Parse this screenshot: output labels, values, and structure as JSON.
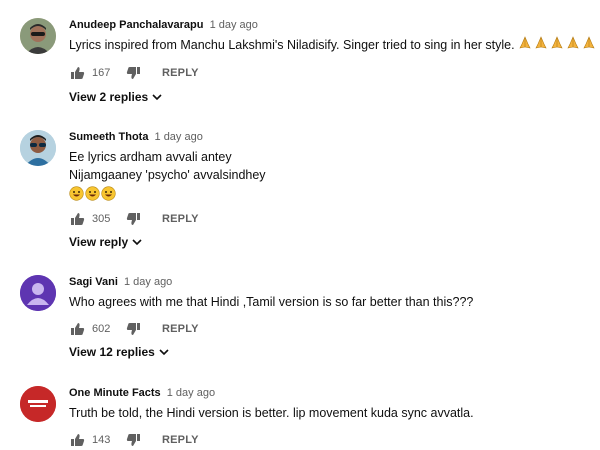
{
  "comments": [
    {
      "author": "Anudeep Panchalavarapu",
      "time": "1 day ago",
      "lines": [
        "Lyrics inspired from Manchu Lakshmi's Niladisify. Singer tried to sing in her style."
      ],
      "emoji_suffix": [
        "folded-hands-icon",
        "folded-hands-icon",
        "folded-hands-icon",
        "folded-hands-icon",
        "folded-hands-icon"
      ],
      "likes": "167",
      "reply_label": "REPLY",
      "replies_label": "View 2 replies"
    },
    {
      "author": "Sumeeth Thota",
      "time": "1 day ago",
      "lines": [
        "Ee lyrics ardham avvali antey",
        "Nijamgaaney 'psycho' avvalsindhey"
      ],
      "emoji_line": [
        "grinning-face-icon",
        "grinning-face-icon",
        "grinning-face-icon"
      ],
      "likes": "305",
      "reply_label": "REPLY",
      "replies_label": "View reply"
    },
    {
      "author": "Sagi Vani",
      "time": "1 day ago",
      "lines": [
        "Who agrees with me that Hindi ,Tamil version is so far better than this???"
      ],
      "likes": "602",
      "reply_label": "REPLY",
      "replies_label": "View 12 replies"
    },
    {
      "author": "One Minute Facts",
      "time": "1 day ago",
      "lines": [
        "Truth be told, the Hindi version is better. lip movement kuda sync avvatla."
      ],
      "likes": "143",
      "reply_label": "REPLY"
    }
  ],
  "icons": {
    "like": "thumb-up-icon",
    "dislike": "thumb-down-icon",
    "expand": "chevron-down-icon"
  },
  "colors": {
    "text": "#0f0f0f",
    "secondary": "#606060",
    "avatar_sagi": "#5e35b1",
    "avatar_omf": "#c62828"
  }
}
